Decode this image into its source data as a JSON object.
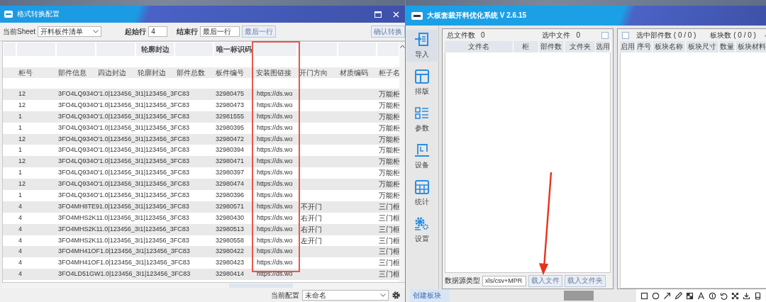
{
  "left_window": {
    "title": "格式转换配置",
    "toolbar": {
      "sheet_label": "当前Sheet",
      "sheet_value": "开料板件清单",
      "start_label": "起始行",
      "start_value": "4",
      "end_label": "结束行",
      "end_value": "最后一行",
      "last_row_button": "最后一行",
      "confirm_button": "确认转换"
    },
    "columns": [
      {
        "label": "柜号"
      },
      {
        "label": "部件信息"
      },
      {
        "label": "四边封边"
      },
      {
        "label": "轮廓封边",
        "group_label": "轮廓封边"
      },
      {
        "label": "部件总数"
      },
      {
        "label": "板件编号",
        "group_label": "唯一标识码"
      },
      {
        "label": "安装图链接"
      },
      {
        "label": "开门方向"
      },
      {
        "label": "材质编码"
      },
      {
        "label": "柜子名"
      }
    ],
    "rows": [
      {
        "cabinet_no": "12",
        "part_info": "3FO4LQ934O'1.0|123456_3I1|123456_3FC83",
        "board_no": "32980475",
        "drawing_link": "https://ds.wo",
        "cabinet_name": "万能柜"
      },
      {
        "cabinet_no": "12",
        "part_info": "3FO4LQ934O'1.0|123456_3I1|123456_3FC83",
        "board_no": "32980473",
        "drawing_link": "https://ds.wo",
        "cabinet_name": "万能柜"
      },
      {
        "cabinet_no": "1",
        "part_info": "3FO4LQ934O'1.0|123456_3I1|123456_3FC83",
        "board_no": "32981555",
        "drawing_link": "https://ds.wo",
        "cabinet_name": "万能柜"
      },
      {
        "cabinet_no": "1",
        "part_info": "3FO4LQ934O'1.0|123456_3I1|123456_3FC83",
        "board_no": "32980395",
        "drawing_link": "https://ds.wo",
        "cabinet_name": "万能柜"
      },
      {
        "cabinet_no": "12",
        "part_info": "3FO4LQ934O'1.0|123456_3I1|123456_3FC83",
        "board_no": "32980472",
        "drawing_link": "https://ds.wo",
        "cabinet_name": "万能柜"
      },
      {
        "cabinet_no": "1",
        "part_info": "3FO4LQ934O'1.0|123456_3I1|123456_3FC83",
        "board_no": "32980394",
        "drawing_link": "https://ds.wo",
        "cabinet_name": "万能柜"
      },
      {
        "cabinet_no": "12",
        "part_info": "3FO4LQ934O'1.0|123456_3I1|123456_3FC83",
        "board_no": "32980471",
        "drawing_link": "https://ds.wo",
        "cabinet_name": "万能柜"
      },
      {
        "cabinet_no": "1",
        "part_info": "3FO4LQ934O'1.0|123456_3I1|123456_3FC83",
        "board_no": "32980397",
        "drawing_link": "https://ds.wo",
        "cabinet_name": "万能柜"
      },
      {
        "cabinet_no": "12",
        "part_info": "3FO4LQ934O'1.0|123456_3I1|123456_3FC83",
        "board_no": "32980474",
        "drawing_link": "https://ds.wo",
        "cabinet_name": "万能柜"
      },
      {
        "cabinet_no": "1",
        "part_info": "3FO4LQ934O'1.0|123456_3I1|123456_3FC83",
        "board_no": "32980396",
        "drawing_link": "https://ds.wo",
        "cabinet_name": "万能柜"
      },
      {
        "cabinet_no": "4",
        "part_info": "3FO4MH8TE91.0|123456_3I1|123456_3FC83",
        "board_no": "32980571",
        "drawing_link": "https://ds.wo",
        "door_direction": "不开门",
        "cabinet_name": "三门框"
      },
      {
        "cabinet_no": "4",
        "part_info": "3FO4MHS2K11.0|123456_3I1|123456_3FC83",
        "board_no": "32980430",
        "drawing_link": "https://ds.wo",
        "door_direction": "右开门",
        "cabinet_name": "三门框"
      },
      {
        "cabinet_no": "4",
        "part_info": "3FO4MHS2K11.0|123456_3I1|123456_3FC83",
        "board_no": "32980513",
        "drawing_link": "https://ds.wo",
        "door_direction": "右开门",
        "cabinet_name": "三门框"
      },
      {
        "cabinet_no": "4",
        "part_info": "3FO4MHS2K11.0|123456_3I1|123456_3FC83",
        "board_no": "32980558",
        "drawing_link": "https://ds.wo",
        "door_direction": "左开门",
        "cabinet_name": "三门框"
      },
      {
        "cabinet_no": "4",
        "part_info": "3FO4MH41OF1.0|123456_3I1|123456_3FC83",
        "board_no": "32980422",
        "drawing_link": "https://ds.wo",
        "cabinet_name": "三门框"
      },
      {
        "cabinet_no": "4",
        "part_info": "3FO4MH41OF1.0|123456_3I1|123456_3FC83",
        "board_no": "32980423",
        "drawing_link": "https://ds.wo",
        "cabinet_name": "三门框"
      },
      {
        "cabinet_no": "4",
        "part_info": "3FO4LD51GW1.0|123456_3I1|123456_3FC83",
        "board_no": "32980414",
        "drawing_link": "https://ds.wo",
        "cabinet_name": "三门框"
      }
    ],
    "current_config_label": "当前配置",
    "current_config_value": "未命名"
  },
  "right_window": {
    "title": "大板套裁开料优化系统  V 2.6.15",
    "nav": [
      {
        "kind": "import",
        "label": "导入",
        "selected": true
      },
      {
        "kind": "layout",
        "label": "排版",
        "selected": false
      },
      {
        "kind": "params",
        "label": "参数",
        "selected": false
      },
      {
        "kind": "device",
        "label": "设备",
        "selected": false
      },
      {
        "kind": "stats",
        "label": "统计",
        "selected": false
      },
      {
        "kind": "settings",
        "label": "设置",
        "selected": false
      }
    ],
    "files_panel": {
      "total_label": "总文件数",
      "total_value": "0",
      "selected_label": "选中文件",
      "selected_value": "0",
      "select_all_checked": false,
      "columns": [
        "文件名",
        "柜",
        "部件数",
        "文件夹",
        "选用"
      ],
      "source_type_label": "数据源类型",
      "source_type_value": "xls/csv+MPR",
      "buttons": [
        "载入文件",
        "载入文件夹"
      ]
    },
    "parts_panel": {
      "checked": false,
      "selected_parts_label": "选中部件数 ( 0 / 0 )",
      "boards_label": "板块数 ( 0 / 0 )",
      "columns": [
        "启用",
        "序号",
        "板块名称",
        "板块尺寸",
        "数量",
        "板块材料"
      ]
    },
    "bottom_bar": {
      "create_board": "创建板块"
    }
  }
}
